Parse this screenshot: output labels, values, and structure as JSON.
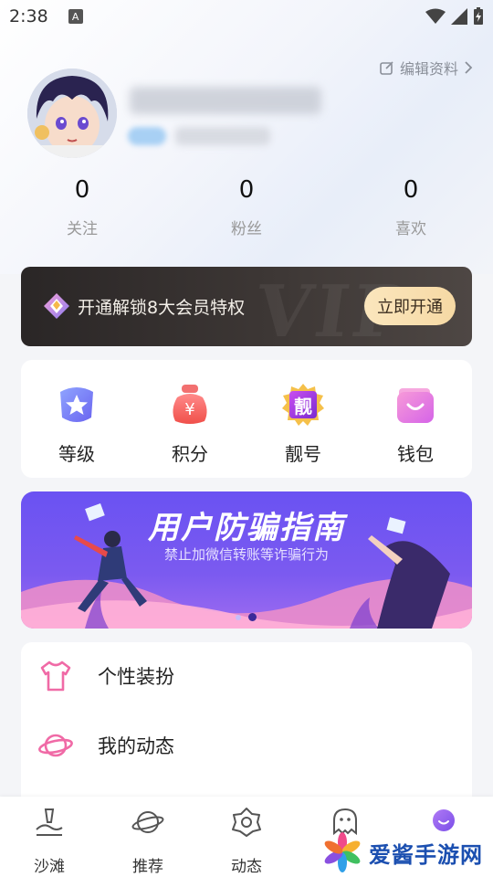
{
  "status_bar": {
    "time": "2:38",
    "a_badge": "A"
  },
  "profile": {
    "edit_label": "编辑资料",
    "stats": [
      {
        "value": "0",
        "label": "关注"
      },
      {
        "value": "0",
        "label": "粉丝"
      },
      {
        "value": "0",
        "label": "喜欢"
      }
    ]
  },
  "vip": {
    "promo_text": "开通解锁8大会员特权",
    "button_label": "立即开通",
    "watermark": "VIP"
  },
  "quick_actions": [
    {
      "label": "等级",
      "icon": "star-badge-icon"
    },
    {
      "label": "积分",
      "icon": "yen-bag-icon"
    },
    {
      "label": "靓号",
      "icon": "pretty-number-icon",
      "glyph": "靓"
    },
    {
      "label": "钱包",
      "icon": "wallet-icon"
    }
  ],
  "banner": {
    "title": "用户防骗指南",
    "subtitle": "禁止加微信转账等诈骗行为",
    "page_count": 2,
    "active_page": 2
  },
  "menu": [
    {
      "label": "个性装扮",
      "icon": "tshirt-icon"
    },
    {
      "label": "我的动态",
      "icon": "planet-icon"
    }
  ],
  "tabbar": [
    {
      "label": "沙滩",
      "icon": "beach-icon"
    },
    {
      "label": "推荐",
      "icon": "planet-icon"
    },
    {
      "label": "动态",
      "icon": "flower-icon"
    },
    {
      "label": "",
      "icon": "ghost-icon"
    },
    {
      "label": "",
      "icon": "me-icon"
    }
  ],
  "watermark_brand": {
    "text": "爱酱手游网"
  },
  "colors": {
    "accent_pink": "#f06aa6",
    "vip_gold": "#f6d9a4",
    "banner_purple": "#6a52f2",
    "me_tab_purple": "#8a5cf0"
  }
}
